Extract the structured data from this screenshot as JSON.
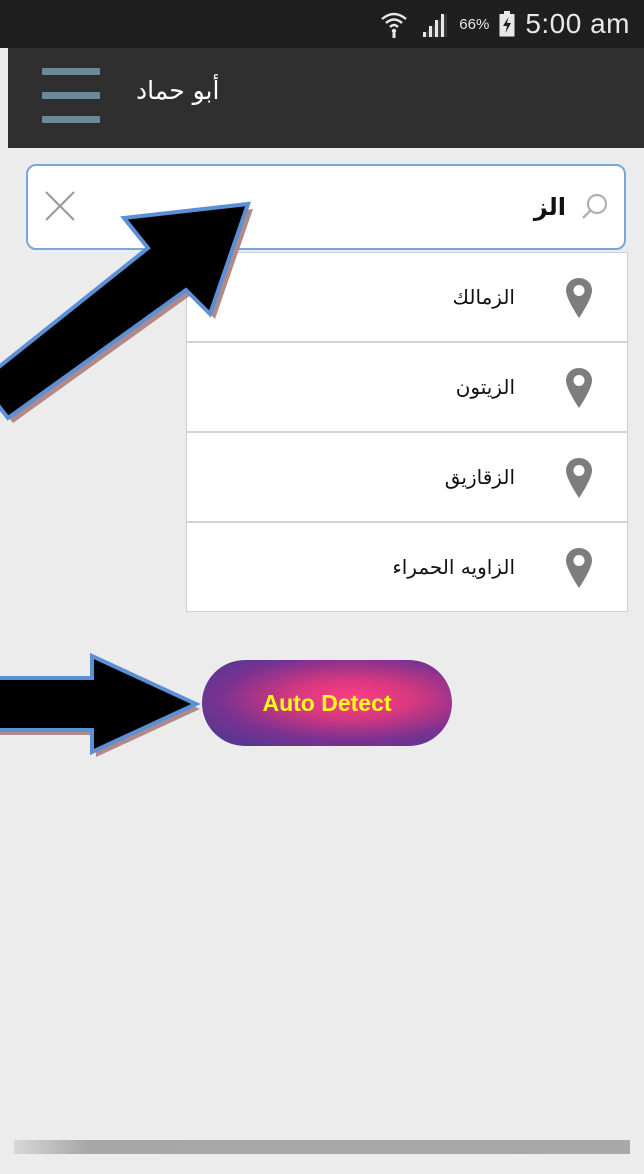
{
  "status_bar": {
    "battery_percent": "66%",
    "time": "5:00 am"
  },
  "app_bar": {
    "title": "أبو حماد"
  },
  "search": {
    "value": "الز"
  },
  "suggestions": [
    {
      "label": "الزمالك"
    },
    {
      "label": "الزيتون"
    },
    {
      "label": "الزقازيق"
    },
    {
      "label": "الزاويه الحمراء"
    }
  ],
  "auto_detect": {
    "label": "Auto Detect"
  },
  "icons": {
    "menu": "hamburger-menu-icon",
    "clear": "close-icon",
    "search": "search-icon",
    "pin": "location-pin-icon"
  },
  "colors": {
    "status_bar": "#1f1f1f",
    "app_bar": "#2f2f2f",
    "menu_icon": "#6b8899",
    "search_border": "#7aa6d8",
    "button_text": "#ffff1a",
    "button_pink": "#ff3d84",
    "button_purple": "#3f3b91",
    "arrow_outline": "#5b8fd6"
  }
}
